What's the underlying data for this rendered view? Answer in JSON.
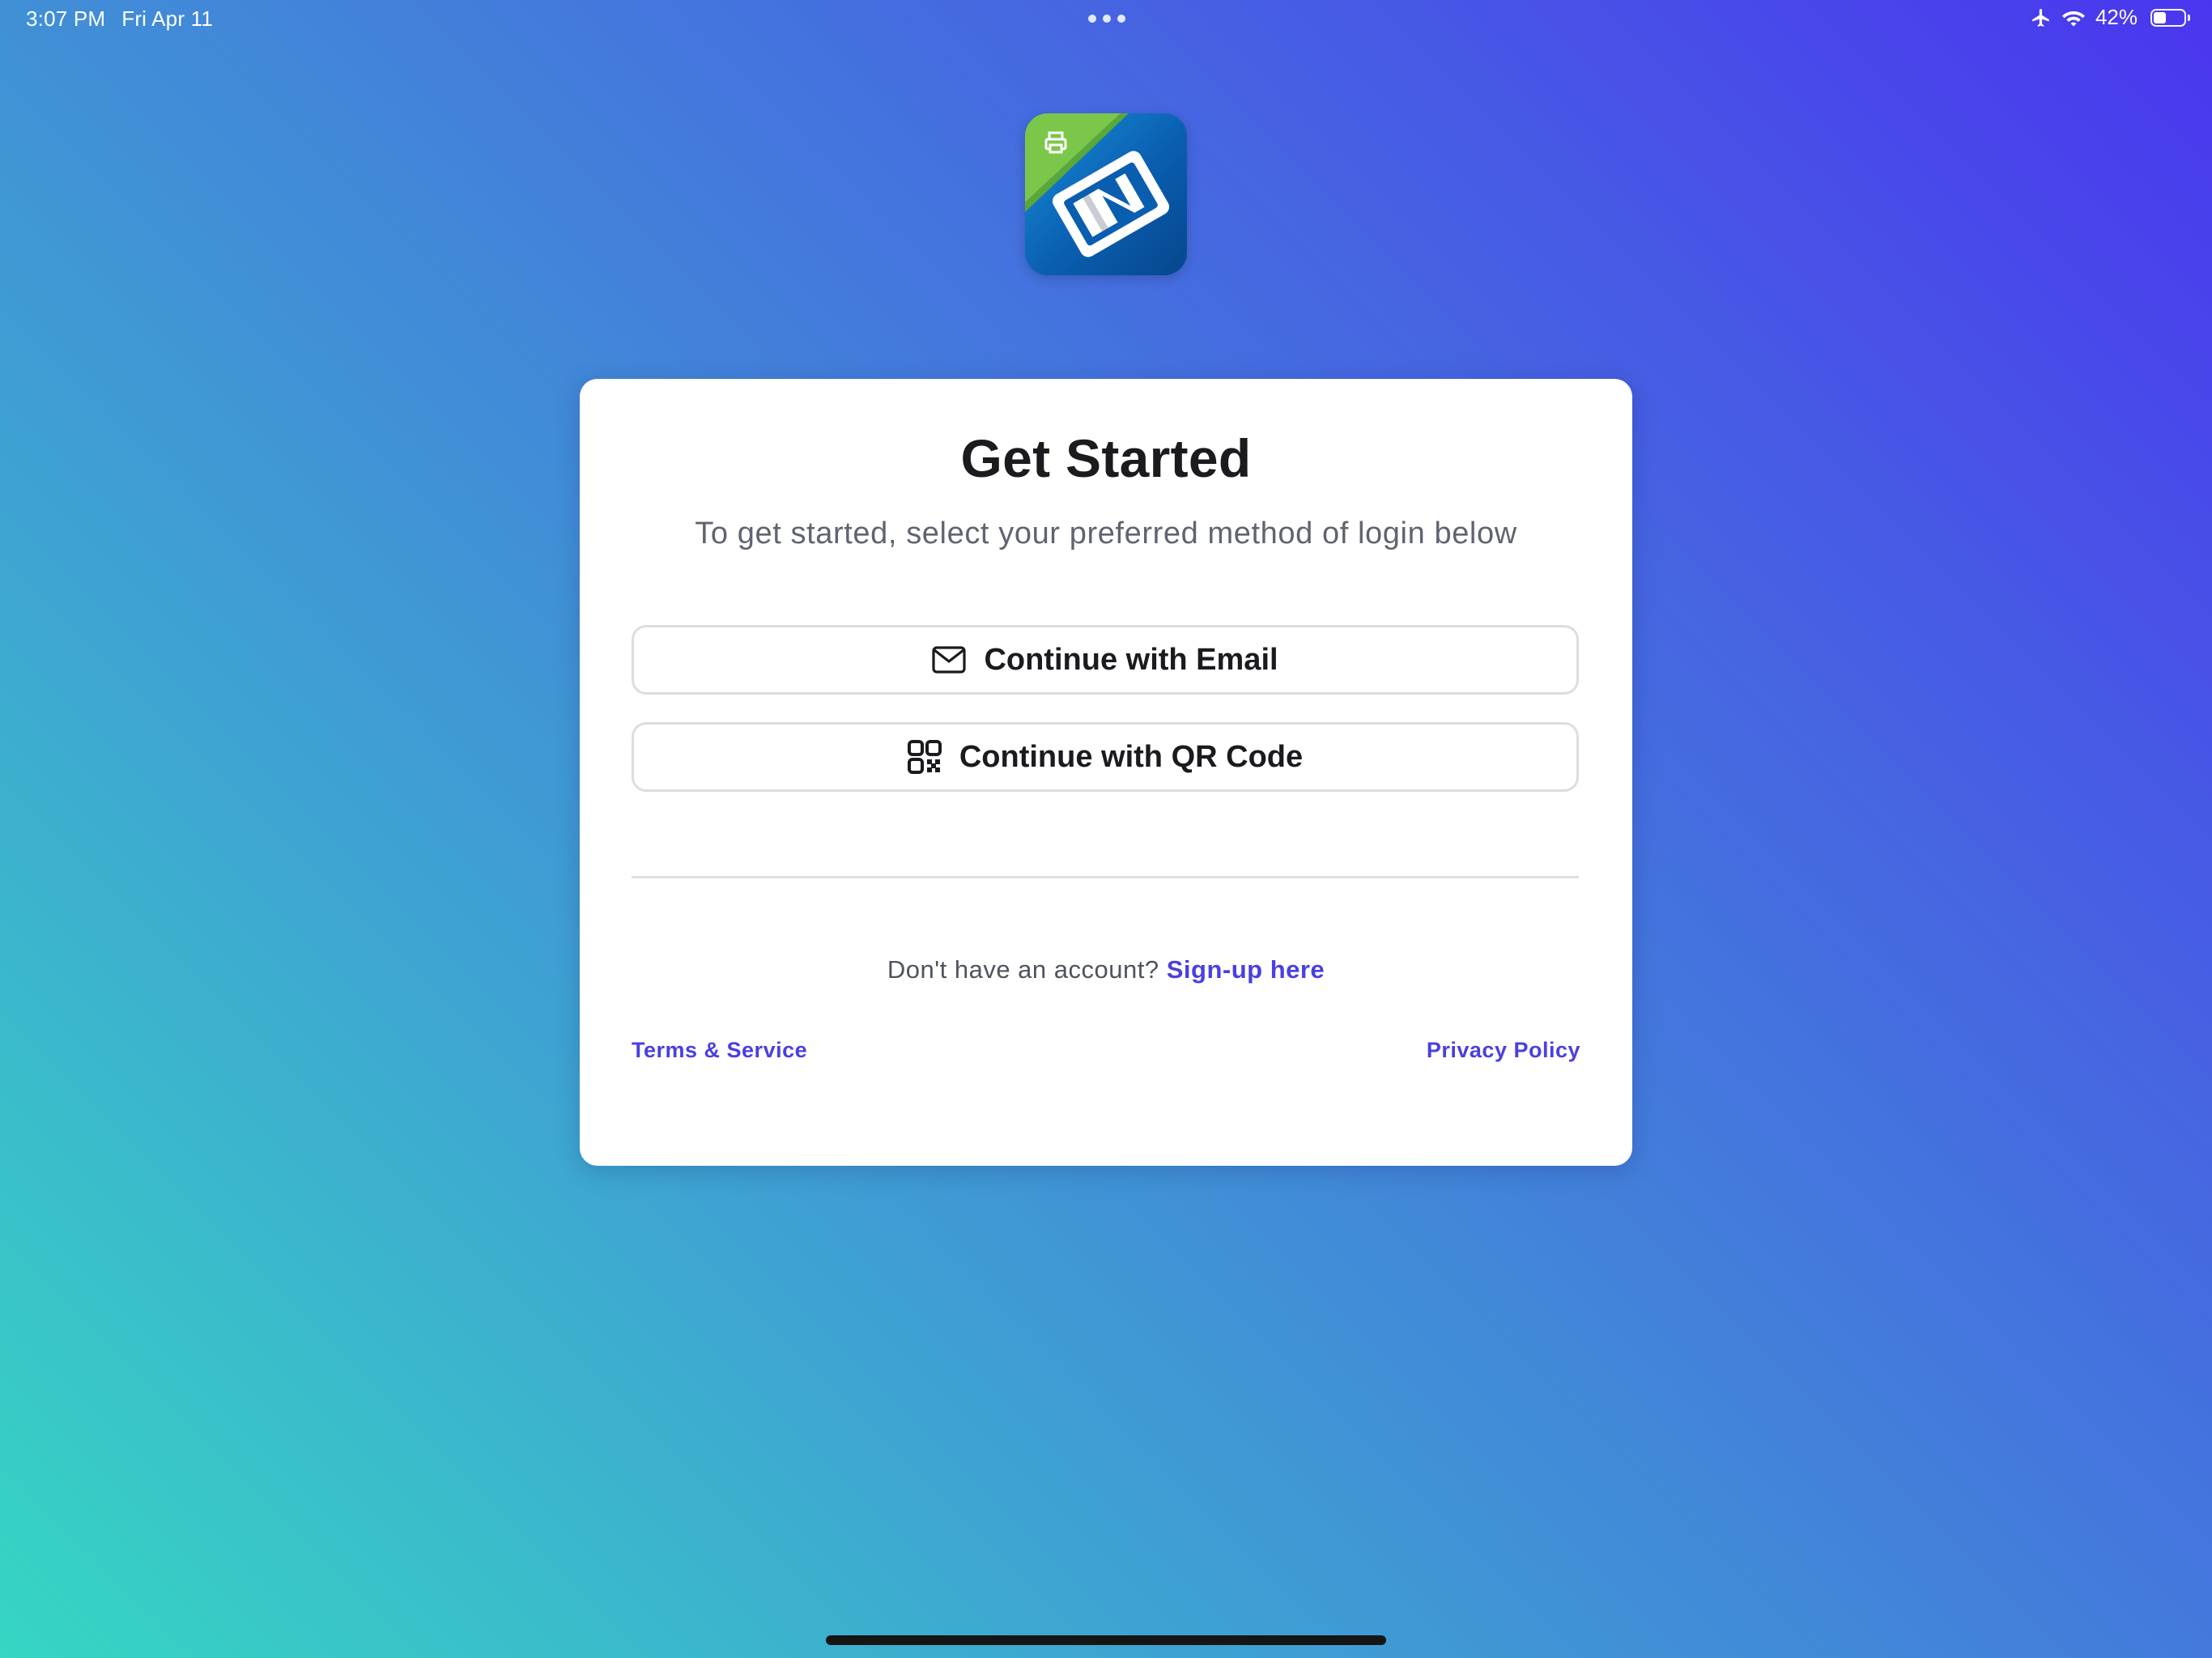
{
  "status_bar": {
    "time": "3:07 PM",
    "date": "Fri Apr 11",
    "battery_text": "42%",
    "battery_level": 0.42
  },
  "logo": {
    "icon": "app-logo-icon",
    "colors": {
      "background": "#0a5eb0",
      "ribbon": "#7bc74a"
    }
  },
  "card": {
    "title": "Get Started",
    "subtitle": "To get started, select your preferred method of login below",
    "buttons": {
      "email_label": "Continue with Email",
      "email_icon": "mail-icon",
      "qr_label": "Continue with QR Code",
      "qr_icon": "qr-code-icon"
    },
    "signup": {
      "prompt": "Don't have an account?",
      "link": "Sign-up here"
    },
    "footer": {
      "terms": "Terms & Service",
      "privacy": "Privacy Policy"
    }
  },
  "colors": {
    "link": "#4a3fe0",
    "gradient_start": "#36d6c3",
    "gradient_end": "#4a36ef"
  }
}
